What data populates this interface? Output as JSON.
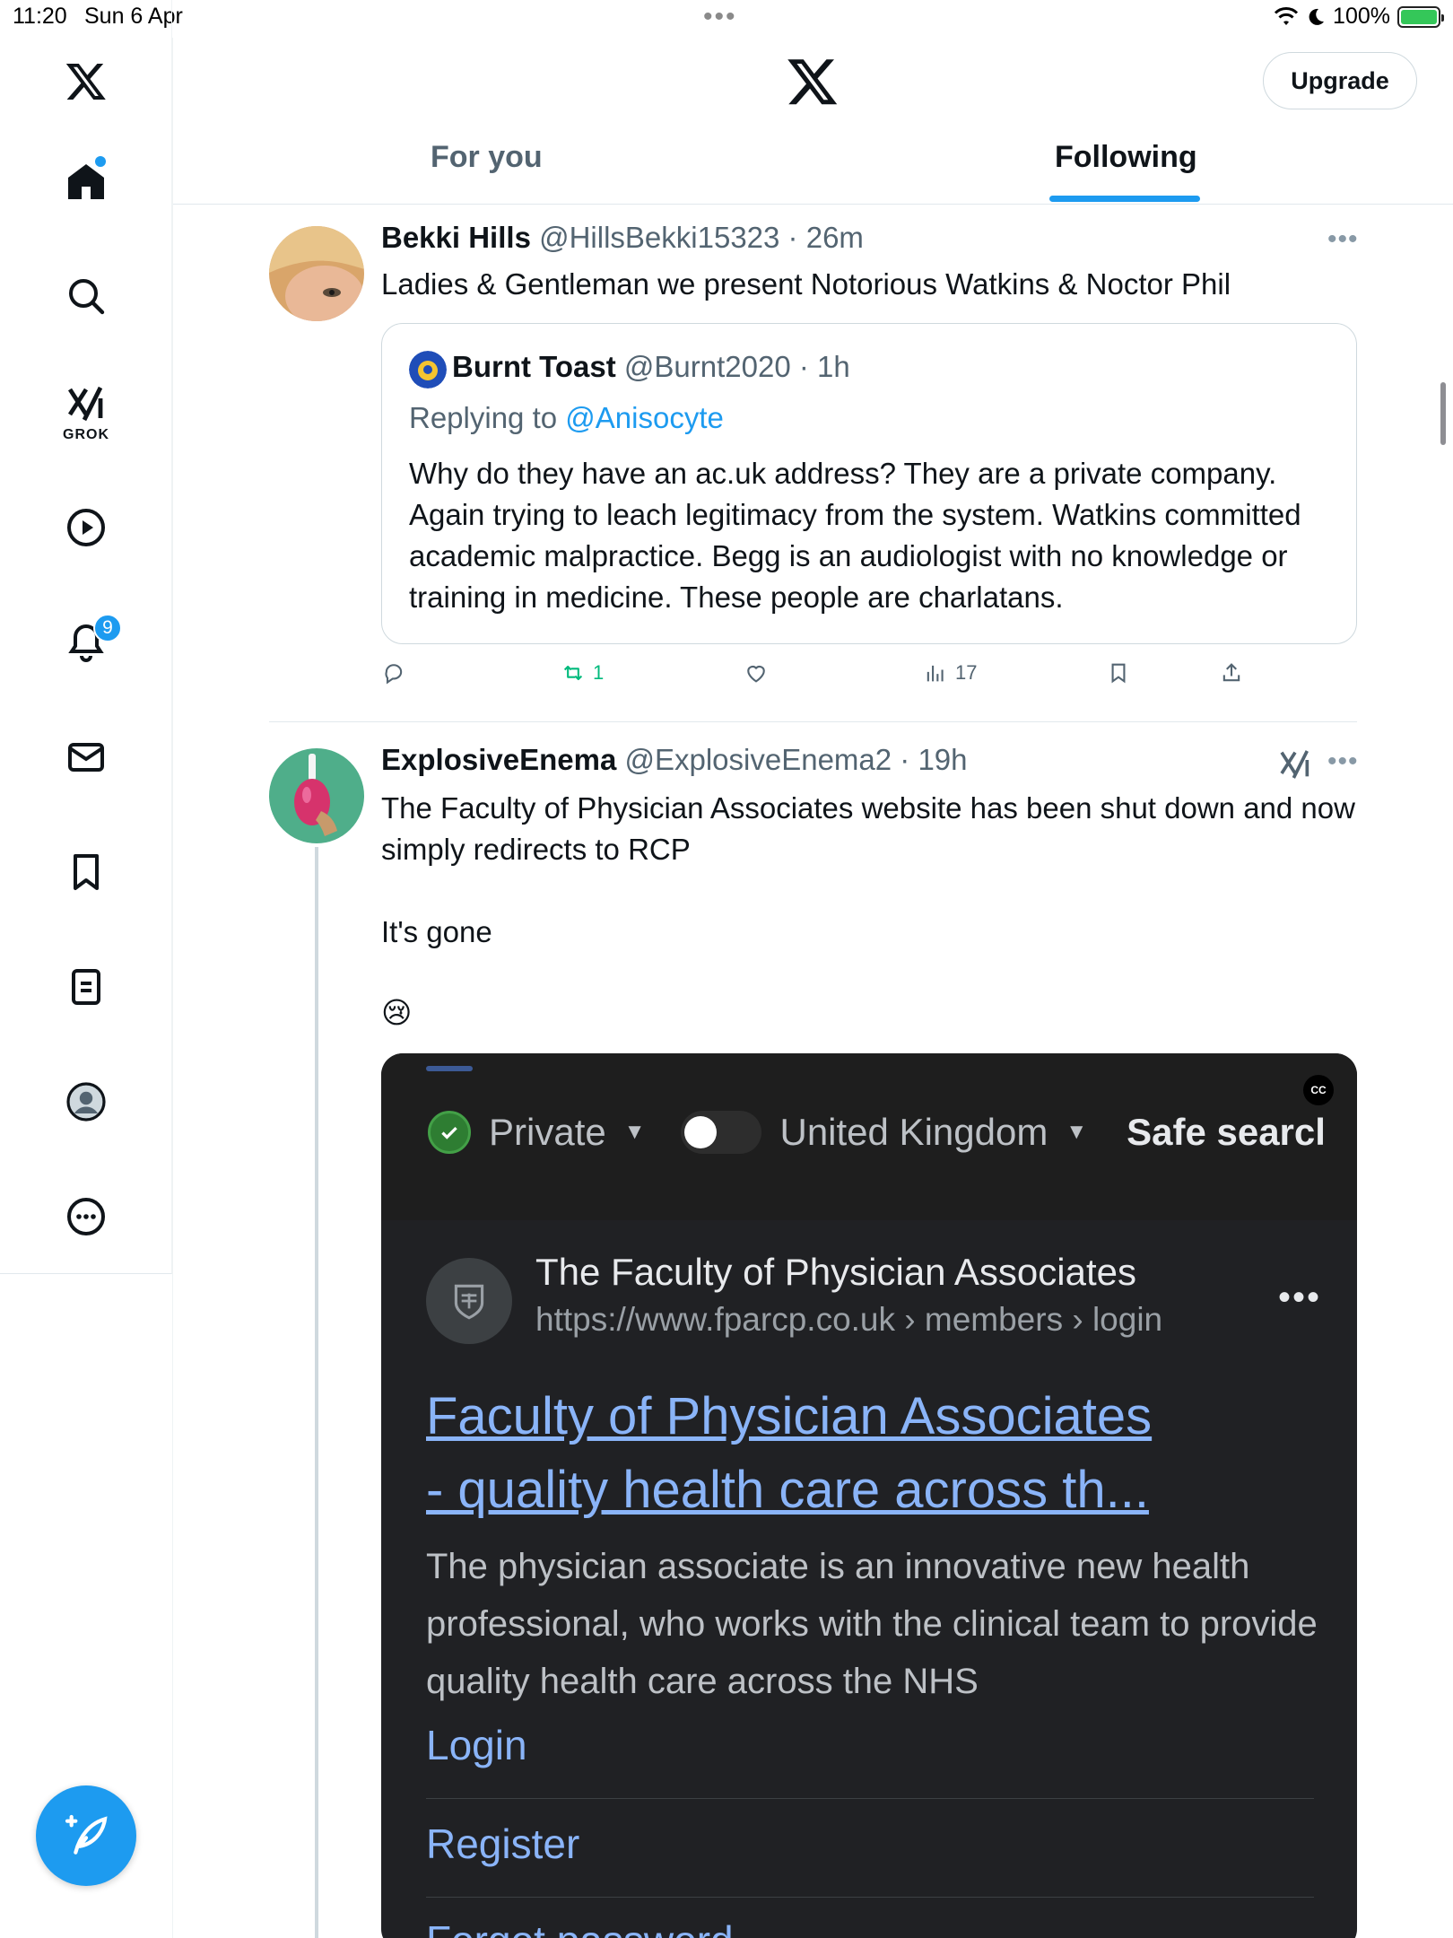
{
  "status_bar": {
    "time": "11:20",
    "date": "Sun 6 Apr",
    "dots": "•••",
    "battery": "100%"
  },
  "sidebar": {
    "items": [
      {
        "icon": "x-logo-icon"
      },
      {
        "icon": "home-icon"
      },
      {
        "icon": "search-icon"
      },
      {
        "icon": "grok-icon",
        "label": "GROK"
      },
      {
        "icon": "video-icon"
      },
      {
        "icon": "notifications-icon",
        "badge": "9"
      },
      {
        "icon": "messages-icon"
      },
      {
        "icon": "bookmarks-icon"
      },
      {
        "icon": "lists-icon"
      },
      {
        "icon": "profile-icon"
      },
      {
        "icon": "more-icon"
      }
    ],
    "compose_icon": "compose-icon"
  },
  "header": {
    "upgrade_label": "Upgrade",
    "tabs": [
      {
        "label": "For you",
        "active": false
      },
      {
        "label": "Following",
        "active": true
      }
    ]
  },
  "colors": {
    "accent": "#1d9bf0",
    "retweet": "#00ba7c",
    "secondary_text": "#536471"
  },
  "tweets": [
    {
      "name": "Bekki Hills",
      "handle": "@HillsBekki15323",
      "time": "26m",
      "text": "Ladies & Gentleman we present Notorious Watkins & Noctor Phil",
      "quote": {
        "name": "Burnt Toast",
        "handle": "@Burnt2020",
        "time": "1h",
        "replying_prefix": "Replying to",
        "replying_to": "@Anisocyte",
        "text": "Why do they have an ac.uk address? They are a private company. Again trying to leach legitimacy from the system. Watkins committed academic malpractice. Begg is an audiologist with no knowledge or training in medicine. These people are charlatans."
      },
      "actions": {
        "reposts": "1",
        "views": "17"
      }
    },
    {
      "name": "ExplosiveEnema",
      "handle": "@ExplosiveEnema2",
      "time": "19h",
      "text_1": "The Faculty of Physician Associates website has been shut down and now simply redirects to RCP",
      "text_2": "It's gone",
      "emoji": "😢",
      "media": {
        "cc_label": "CC",
        "filter_private": "Private",
        "region": "United Kingdom",
        "safe_search": "Safe searcl",
        "site_name": "The Faculty of Physician Associates",
        "site_url": "https://www.fparcp.co.uk › members › login",
        "result_title_1": "Faculty of Physician Associates",
        "result_title_2": "- quality health care across th...",
        "description": "The physician associate is an innovative new health professional, who works with the clinical team to provide quality health care across the NHS",
        "links": [
          "Login",
          "Register",
          "Forgot password"
        ]
      }
    }
  ]
}
